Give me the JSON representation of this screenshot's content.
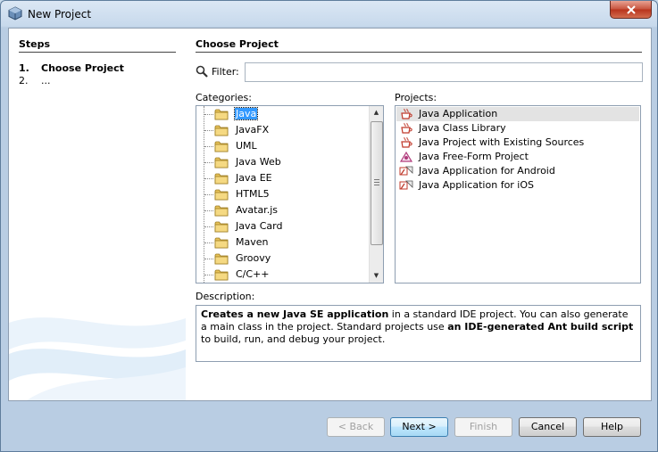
{
  "window": {
    "title": "New Project"
  },
  "steps": {
    "heading": "Steps",
    "items": [
      {
        "num": "1.",
        "label": "Choose Project"
      },
      {
        "num": "2.",
        "label": "..."
      }
    ]
  },
  "main": {
    "title": "Choose Project",
    "filter_label": "Filter:",
    "filter_value": "",
    "categories_label": "Categories:",
    "projects_label": "Projects:",
    "categories": [
      "Java",
      "JavaFX",
      "UML",
      "Java Web",
      "Java EE",
      "HTML5",
      "Avatar.js",
      "Java Card",
      "Maven",
      "Groovy",
      "C/C++"
    ],
    "selected_category": "Java",
    "projects": [
      {
        "label": "Java Application",
        "icon": "java-cup-icon"
      },
      {
        "label": "Java Class Library",
        "icon": "java-cup-icon"
      },
      {
        "label": "Java Project with Existing Sources",
        "icon": "java-cup-icon"
      },
      {
        "label": "Java Free-Form Project",
        "icon": "freeform-icon"
      },
      {
        "label": "Java Application for Android",
        "icon": "android-app-icon"
      },
      {
        "label": "Java Application for iOS",
        "icon": "ios-app-icon"
      }
    ],
    "selected_project": "Java Application",
    "description_label": "Description:",
    "description": {
      "bold1": "Creates a new Java SE application",
      "text1": " in a standard IDE project. You can also generate a main class in the project. Standard projects use ",
      "bold2": "an IDE-generated Ant build script",
      "text2": " to build, run, and debug your project."
    }
  },
  "buttons": {
    "back": "< Back",
    "next": "Next >",
    "finish": "Finish",
    "cancel": "Cancel",
    "help": "Help"
  },
  "colors": {
    "selection": "#3399ff",
    "window_frame": "#c7d9ec"
  }
}
